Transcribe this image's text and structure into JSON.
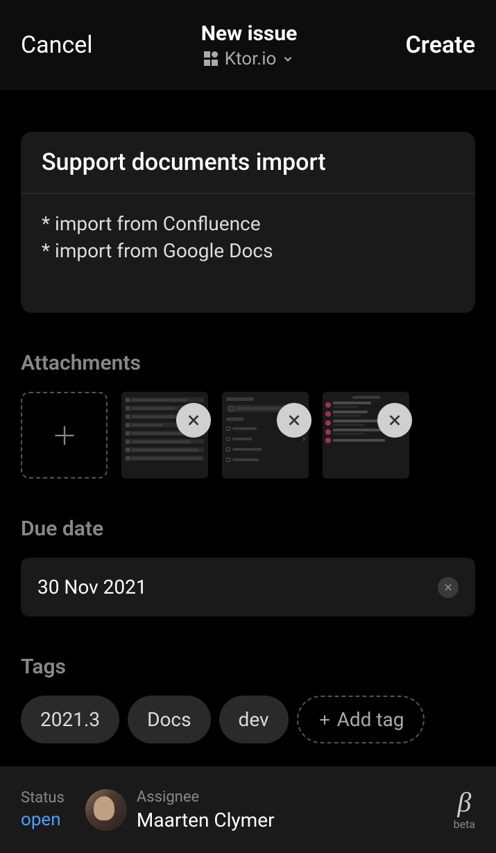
{
  "header": {
    "cancel_label": "Cancel",
    "title": "New issue",
    "project_name": "Ktor.io",
    "create_label": "Create"
  },
  "issue": {
    "title": "Support documents import",
    "body": "* import from Confluence\n* import from Google Docs"
  },
  "sections": {
    "attachments_label": "Attachments",
    "due_date_label": "Due date",
    "tags_label": "Tags"
  },
  "due_date": {
    "value": "30 Nov 2021"
  },
  "tags": {
    "items": [
      "2021.3",
      "Docs",
      "dev"
    ],
    "add_label": "Add tag"
  },
  "footer": {
    "status_label": "Status",
    "status_value": "open",
    "assignee_label": "Assignee",
    "assignee_name": "Maarten Clymer",
    "beta_symbol": "β",
    "beta_label": "beta"
  }
}
